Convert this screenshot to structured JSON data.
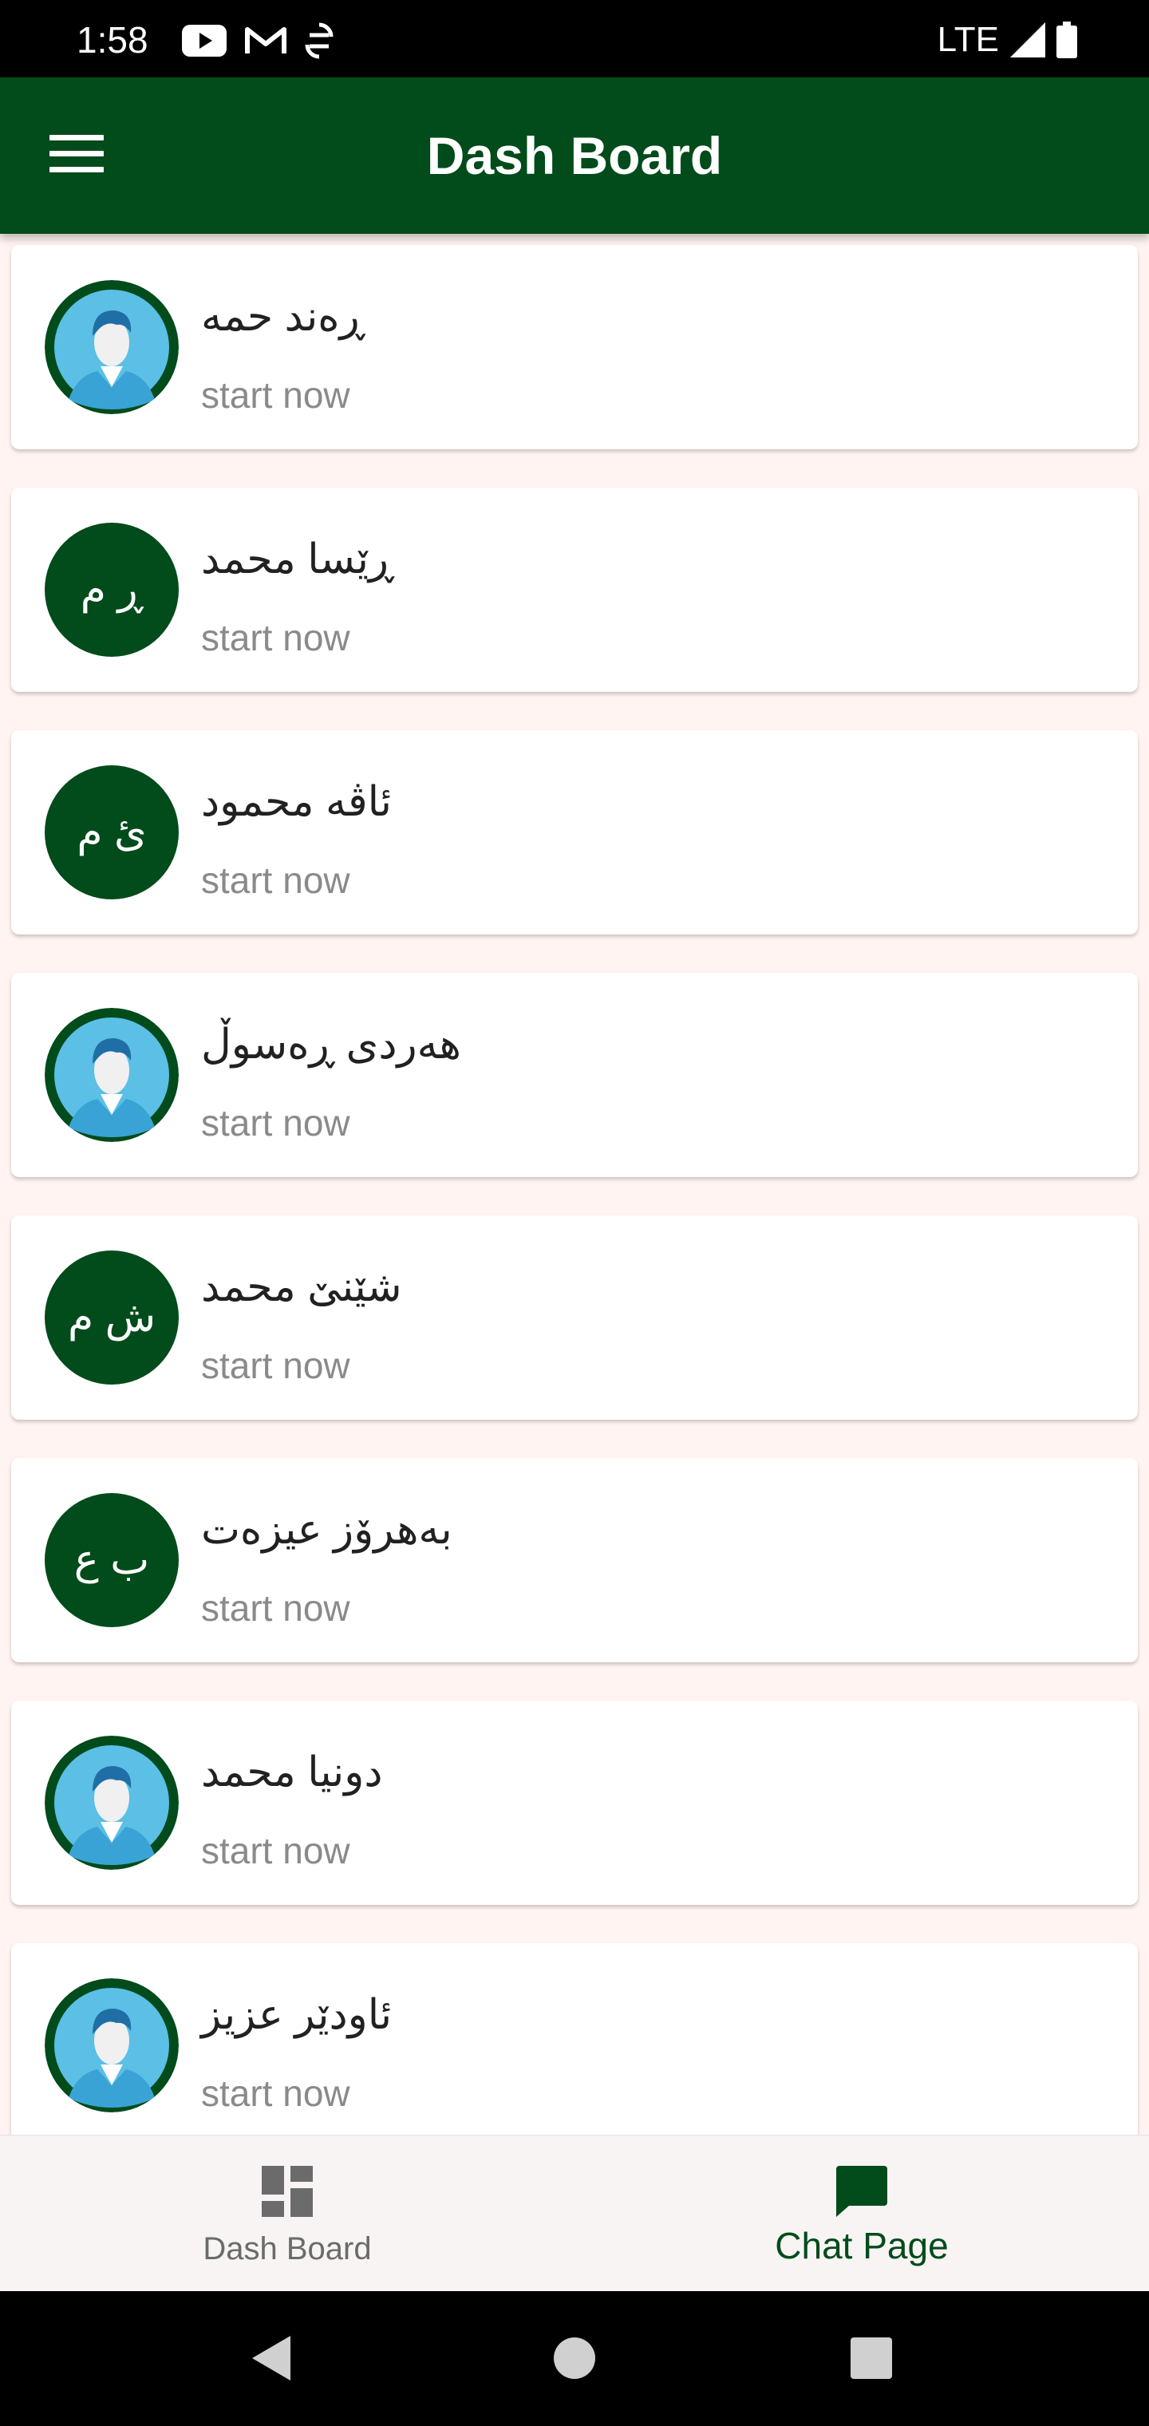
{
  "status_bar": {
    "time": "1:58",
    "network": "LTE",
    "icons": [
      "youtube-icon",
      "gmail-icon",
      "sim-icon",
      "signal-icon",
      "battery-icon"
    ]
  },
  "app_bar": {
    "title": "Dash Board",
    "menu_icon": "menu-icon",
    "color": "#024b1b"
  },
  "contacts": [
    {
      "name": "ڕەند حمە",
      "subtitle": "start now",
      "avatar": "photo"
    },
    {
      "name": "ڕێسا محمد",
      "subtitle": "start now",
      "avatar": "initials",
      "initials": "ڕ م"
    },
    {
      "name": "ئاڤە محمود",
      "subtitle": "start now",
      "avatar": "initials",
      "initials": "ئ م"
    },
    {
      "name": "هەردی ڕەسوڵ",
      "subtitle": "start now",
      "avatar": "photo"
    },
    {
      "name": "شێنێ محمد",
      "subtitle": "start now",
      "avatar": "initials",
      "initials": "ش م"
    },
    {
      "name": "بەهرۆز عیزەت",
      "subtitle": "start now",
      "avatar": "initials",
      "initials": "ب ع"
    },
    {
      "name": "دونیا محمد",
      "subtitle": "start now",
      "avatar": "photo"
    },
    {
      "name": "ئاودێر عزیز",
      "subtitle": "start now",
      "avatar": "photo"
    }
  ],
  "bottom_nav": {
    "items": [
      {
        "label": "Dash Board",
        "icon": "dashboard-icon",
        "active": false
      },
      {
        "label": "Chat Page",
        "icon": "chat-icon",
        "active": true
      }
    ]
  },
  "system_nav": {
    "icons": [
      "back-icon",
      "home-icon",
      "recents-icon"
    ]
  },
  "colors": {
    "primary": "#024b1b",
    "list_background": "#fff4f1",
    "subtitle": "#8a8a8a"
  }
}
